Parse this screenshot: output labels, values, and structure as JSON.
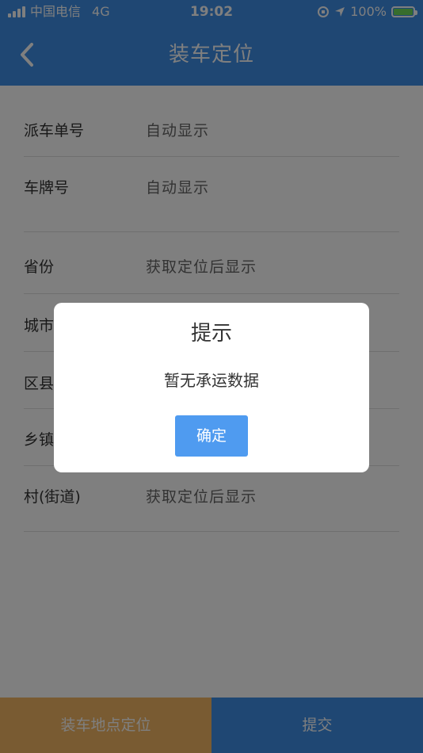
{
  "status_bar": {
    "carrier": "中国电信",
    "network": "4G",
    "time": "19:02",
    "battery": "100%"
  },
  "nav": {
    "title": "装车定位"
  },
  "form": {
    "rows": [
      {
        "label": "派车单号",
        "value": "自动显示"
      },
      {
        "label": "车牌号",
        "value": "自动显示"
      },
      {
        "label": "省份",
        "value": "获取定位后显示"
      },
      {
        "label": "城市",
        "value": ""
      },
      {
        "label": "区县",
        "value": ""
      },
      {
        "label": "乡镇",
        "value": ""
      },
      {
        "label": "村(街道)",
        "value": "获取定位后显示"
      }
    ]
  },
  "bottom": {
    "locate_label": "装车地点定位",
    "submit_label": "提交"
  },
  "modal": {
    "title": "提示",
    "message": "暂无承运数据",
    "confirm_label": "确定"
  },
  "colors": {
    "primary": "#3f8ee6",
    "accent": "#f2b765",
    "modal_button": "#4f9bf0"
  }
}
